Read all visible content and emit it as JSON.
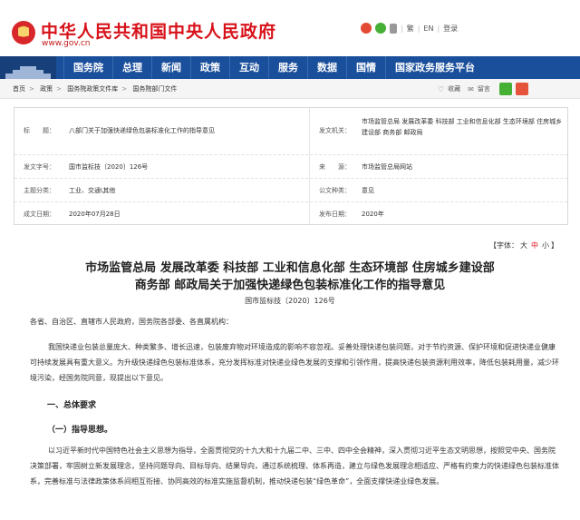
{
  "header": {
    "site_title": "中华人民共和国中央人民政府",
    "site_url": "www.gov.cn",
    "tools": [
      "繁",
      "EN",
      "登录"
    ]
  },
  "nav": {
    "items": [
      "国务院",
      "总理",
      "新闻",
      "政策",
      "互动",
      "服务",
      "数据",
      "国情",
      "国家政务服务平台"
    ]
  },
  "breadcrumb": {
    "items": [
      "首页",
      "政策",
      "国务院政策文件库",
      "国务院部门文件"
    ],
    "tools": [
      "收藏",
      "留言"
    ]
  },
  "info": {
    "title_label": "标　　题：",
    "title_value": "八部门关于加强快递绿色包装标准化工作的指导意见",
    "issuer_label": "发文机关：",
    "issuer_value": "市场监管总局 发展改革委 科技部 工业和信息化部 生态环境部 住房城乡建设部 商务部 邮政局",
    "docno_label": "发文字号：",
    "docno_value": "国市监标技〔2020〕126号",
    "source_label": "来　　源：",
    "source_value": "市场监管总局网站",
    "category_label": "主题分类：",
    "category_value": "工业、交通\\其他",
    "type_label": "公文种类：",
    "type_value": "意见",
    "date_label": "成文日期：",
    "date_value": "2020年07月28日",
    "pubdate_label": "发布日期：",
    "pubdate_value": "2020年"
  },
  "fontsize": {
    "prefix": "【字体：",
    "large": "大",
    "medium": "中",
    "small": "小",
    "suffix": "】"
  },
  "document": {
    "title_line1": "市场监管总局 发展改革委 科技部 工业和信息化部 生态环境部 住房城乡建设部",
    "title_line2": "商务部 邮政局关于加强快递绿色包装标准化工作的指导意见",
    "number": "国市监标技〔2020〕126号",
    "addressee": "各省、自治区、直辖市人民政府，国务院各部委、各直属机构：",
    "para1": "我国快递业包装总量庞大、种类繁多、增长迅速，包装废弃物对环境造成的影响不容忽视。妥善处理快递包装问题，对于节约资源、保护环境和促进快递业健康可持续发展具有重大意义。为升级快递绿色包装标准体系，充分发挥标准对快递业绿色发展的支撑和引领作用，提高快递包装资源利用效率，降低包装耗用量，减少环境污染，经国务院同意，现提出以下意见。",
    "section1": "一、总体要求",
    "sub1": "（一）指导思想。",
    "para2": "以习近平新时代中国特色社会主义思想为指导，全面贯彻党的十九大和十九届二中、三中、四中全会精神，深入贯彻习近平生态文明思想，按照党中央、国务院决策部署，牢固树立新发展理念，坚持问题导向、目标导向、结果导向，通过系统梳理、体系再造，建立与绿色发展理念相适应、严格有约束力的快递绿色包装标准体系，完善标准与法律政策体系间相互衔接、协同高效的标准实施监督机制，推动快递包装“绿色革命”，全面支撑快递业绿色发展。"
  }
}
